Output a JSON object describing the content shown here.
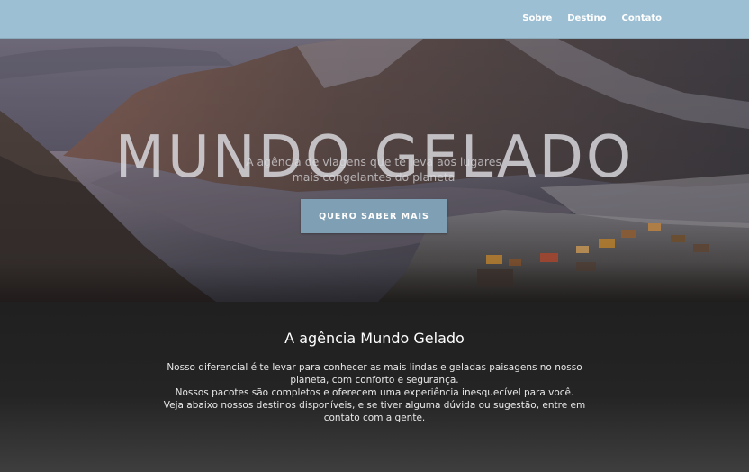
{
  "nav": {
    "links": [
      "Sobre",
      "Destino",
      "Contato"
    ]
  },
  "hero": {
    "title": "MUNDO GELADO",
    "subtitle_line1": "A agência de viagens que te leva aos lugares",
    "subtitle_line2": "mais congelantes do planeta",
    "cta_label": "QUERO SABER MAIS"
  },
  "about": {
    "title": "A agência Mundo Gelado",
    "paragraph1": "Nosso diferencial é te levar para conhecer as mais lindas e geladas paisagens no nosso planeta, com conforto e segurança.",
    "paragraph2": "Nossos pacotes são completos e oferecem uma experiência inesquecível para você.",
    "paragraph3": "Veja abaixo nossos destinos disponíveis, e se tiver alguma dúvida ou sugestão, entre em contato com a gente."
  },
  "colors": {
    "navbar": "#9dbfd3",
    "button": "#7f9fb5",
    "about_bg": "#222222"
  }
}
